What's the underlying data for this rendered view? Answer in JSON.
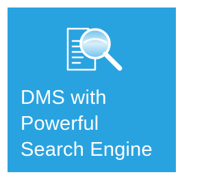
{
  "tile": {
    "background_color": "#29a3e0",
    "icon": "document-search-icon",
    "icon_color": "#ffffff",
    "title_lines": [
      "DMS with",
      "Powerful",
      "Search Engine"
    ]
  }
}
